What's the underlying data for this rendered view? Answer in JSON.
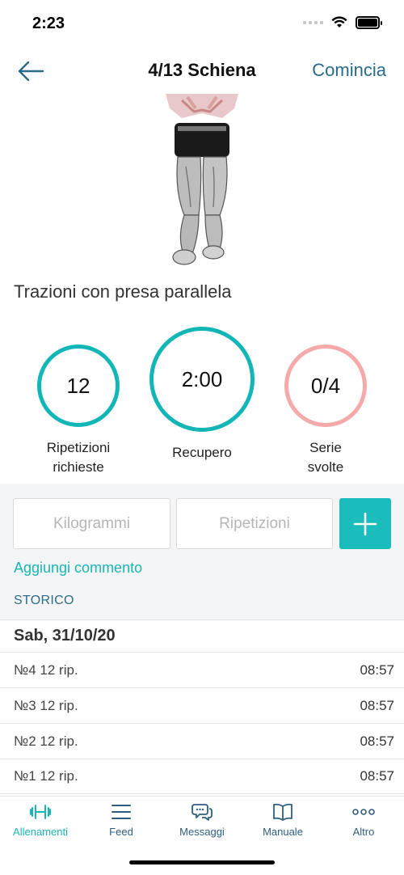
{
  "status_bar": {
    "time": "2:23"
  },
  "nav": {
    "title": "4/13 Schiena",
    "start_label": "Comincia"
  },
  "exercise": {
    "name": "Trazioni con presa parallela"
  },
  "stats": [
    {
      "value": "12",
      "label_line1": "Ripetizioni",
      "label_line2": "richieste",
      "color": "#12b6b6"
    },
    {
      "value": "2:00",
      "label_line1": "Recupero",
      "label_line2": "",
      "color": "#12b6b6"
    },
    {
      "value": "0/4",
      "label_line1": "Serie",
      "label_line2": "svolte",
      "color": "#f5a9a9"
    }
  ],
  "inputs": {
    "kg_placeholder": "Kilogrammi",
    "reps_placeholder": "Ripetizioni"
  },
  "add_comment_label": "Aggiungi commento",
  "history_header": "STORICO",
  "history": {
    "date": "Sab, 31/10/20",
    "rows": [
      {
        "label": "№4 12 rip.",
        "time": "08:57"
      },
      {
        "label": "№3 12 rip.",
        "time": "08:57"
      },
      {
        "label": "№2 12 rip.",
        "time": "08:57"
      },
      {
        "label": "№1 12 rip.",
        "time": "08:57"
      }
    ]
  },
  "tabs": [
    {
      "label": "Allenamenti",
      "icon": "dumbbell-icon",
      "active": true
    },
    {
      "label": "Feed",
      "icon": "feed-lines-icon",
      "active": false
    },
    {
      "label": "Messaggi",
      "icon": "chat-bubbles-icon",
      "active": false
    },
    {
      "label": "Manuale",
      "icon": "book-icon",
      "active": false
    },
    {
      "label": "Altro",
      "icon": "more-dots-icon",
      "active": false
    }
  ],
  "colors": {
    "accent": "#1bbcbc",
    "nav_blue": "#2a6a8a",
    "pink": "#f5a9a9"
  }
}
